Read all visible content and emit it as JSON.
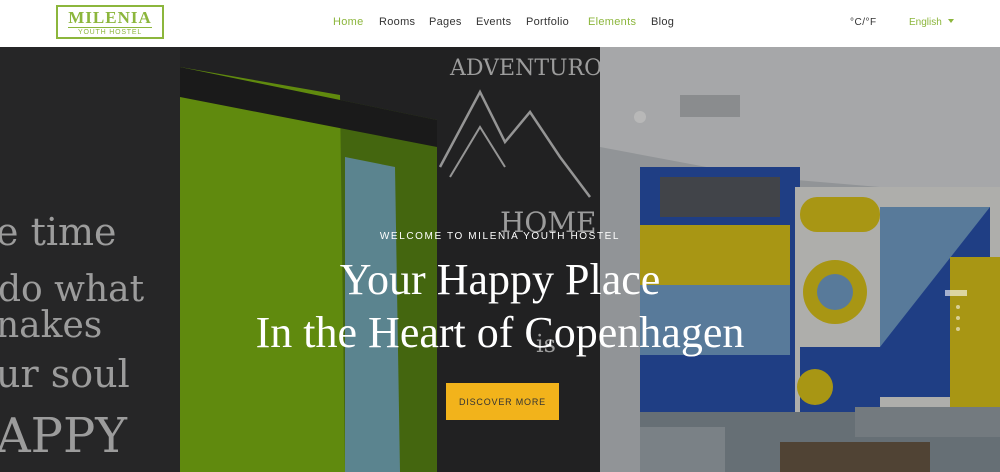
{
  "logo": {
    "name": "MILENIA",
    "tagline": "YOUTH HOSTEL"
  },
  "nav": {
    "items": [
      {
        "label": "Home",
        "active": true
      },
      {
        "label": "Rooms",
        "active": false
      },
      {
        "label": "Pages",
        "active": false
      },
      {
        "label": "Events",
        "active": false
      },
      {
        "label": "Portfolio",
        "active": false
      },
      {
        "label": "Elements",
        "active": true
      },
      {
        "label": "Blog",
        "active": false
      }
    ],
    "units": "°C/°F",
    "language": "English"
  },
  "hero": {
    "eyebrow": "WELCOME TO MILENIA YOUTH HOSTEL",
    "headline_line1": "Your Happy Place",
    "headline_line2": "In the Heart of Copenhagen",
    "cta_label": "DISCOVER MORE",
    "wall_writing": [
      "ADVENTUROUS",
      "HOME",
      "is",
      "e time",
      "do what",
      "nakes",
      "ur soul",
      "APPY"
    ]
  },
  "colors": {
    "accent": "#8cb63c",
    "cta": "#f2b31b",
    "text": "#333333"
  },
  "icons": [
    "chevron-down-icon"
  ]
}
